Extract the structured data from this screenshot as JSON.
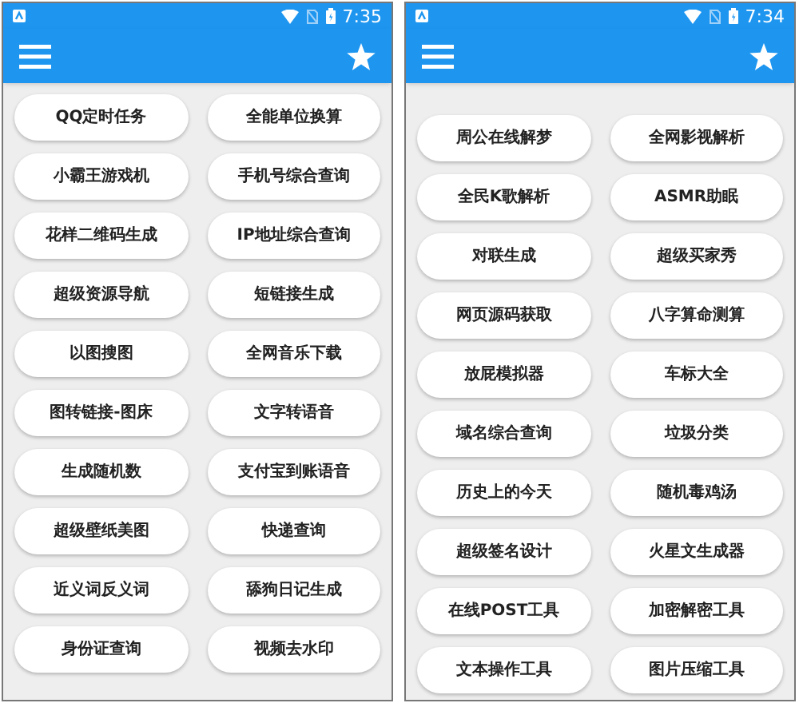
{
  "screens": [
    {
      "status_bar": {
        "time": "7:35"
      },
      "items": [
        "QQ定时任务",
        "全能单位换算",
        "小霸王游戏机",
        "手机号综合查询",
        "花样二维码生成",
        "IP地址综合查询",
        "超级资源导航",
        "短链接生成",
        "以图搜图",
        "全网音乐下载",
        "图转链接-图床",
        "文字转语音",
        "生成随机数",
        "支付宝到账语音",
        "超级壁纸美图",
        "快递查询",
        "近义词反义词",
        "舔狗日记生成",
        "身份证查询",
        "视频去水印"
      ]
    },
    {
      "status_bar": {
        "time": "7:34"
      },
      "items": [
        "周公在线解梦",
        "全网影视解析",
        "全民K歌解析",
        "ASMR助眠",
        "对联生成",
        "超级买家秀",
        "网页源码获取",
        "八字算命测算",
        "放屁模拟器",
        "车标大全",
        "域名综合查询",
        "垃圾分类",
        "历史上的今天",
        "随机毒鸡汤",
        "超级签名设计",
        "火星文生成器",
        "在线POST工具",
        "加密解密工具",
        "文本操作工具",
        "图片压缩工具"
      ]
    }
  ]
}
